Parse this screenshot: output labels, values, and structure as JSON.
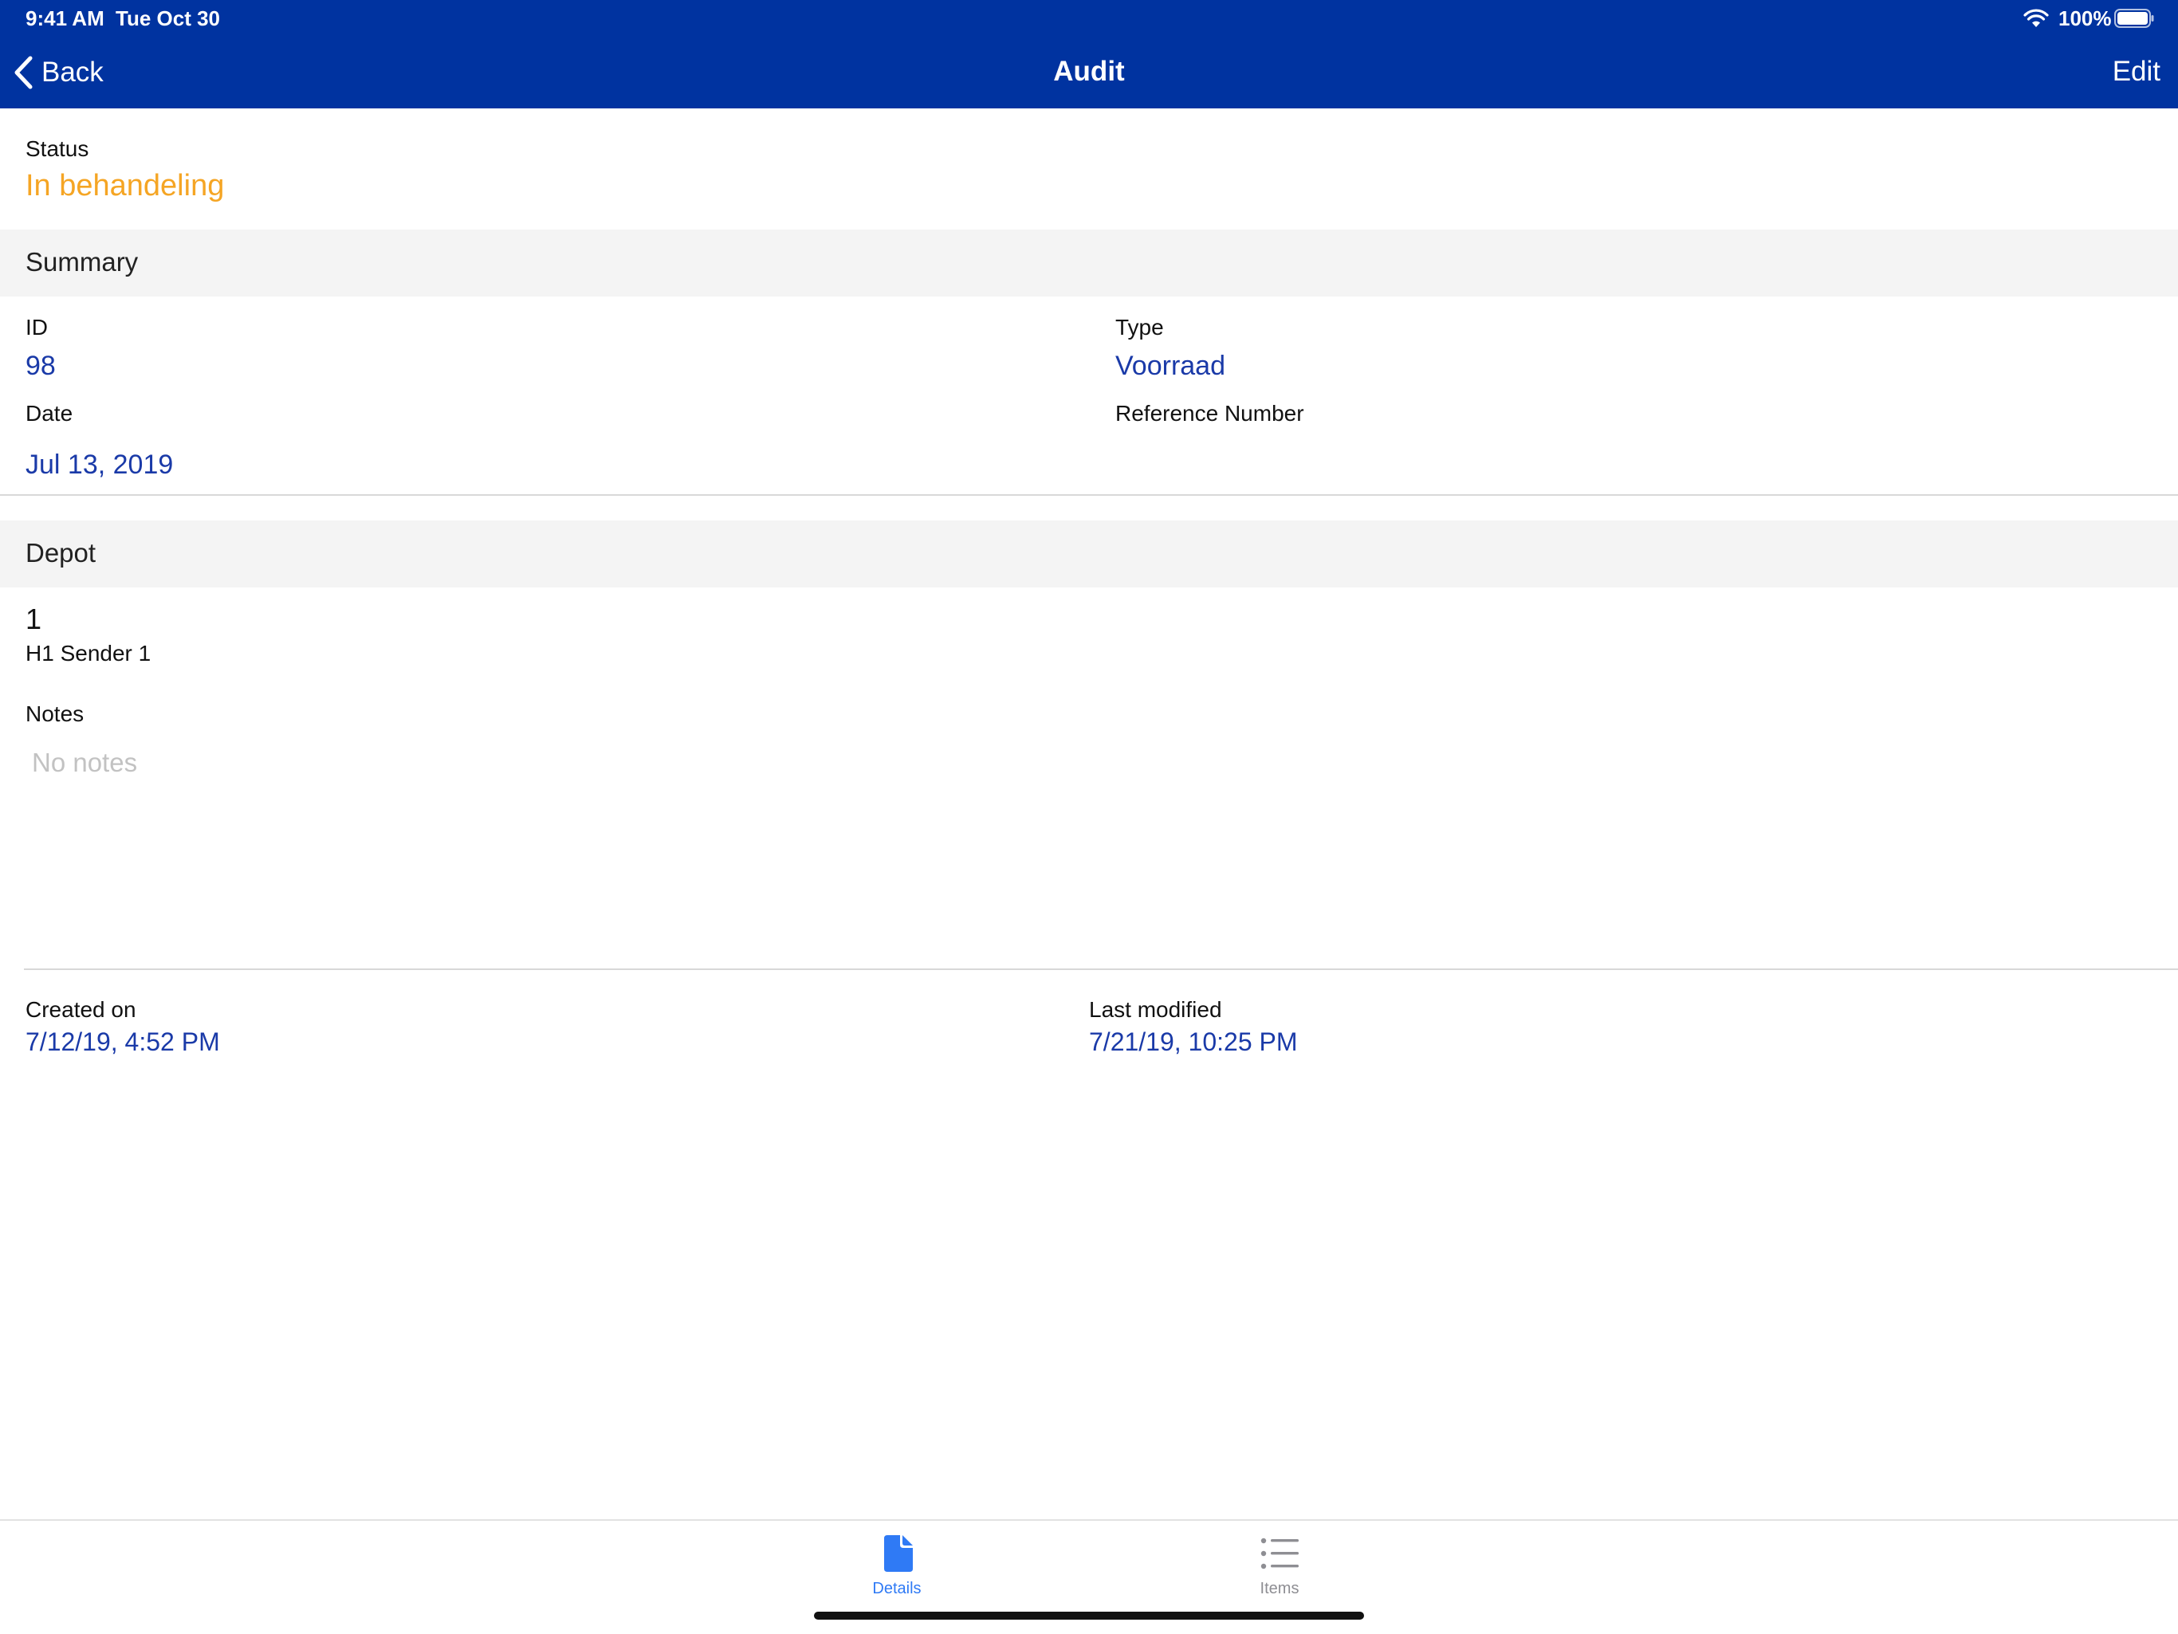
{
  "status_bar": {
    "time": "9:41 AM",
    "date": "Tue Oct 30",
    "battery": "100%"
  },
  "nav": {
    "back_label": "Back",
    "title": "Audit",
    "edit_label": "Edit"
  },
  "status": {
    "label": "Status",
    "value": "In behandeling",
    "value_color": "#f5a524"
  },
  "summary": {
    "title": "Summary",
    "id_label": "ID",
    "id_value": "98",
    "type_label": "Type",
    "type_value": "Voorraad",
    "date_label": "Date",
    "date_value": "Jul 13, 2019",
    "reference_label": "Reference Number"
  },
  "depot": {
    "title": "Depot",
    "code": "1",
    "name": "H1 Sender 1"
  },
  "notes": {
    "label": "Notes",
    "placeholder": "No notes"
  },
  "meta": {
    "created_label": "Created on",
    "created_value": "7/12/19, 4:52 PM",
    "modified_label": "Last modified",
    "modified_value": "7/21/19, 10:25 PM"
  },
  "tabs": [
    {
      "label": "Details",
      "icon": "document-icon",
      "selected": true
    },
    {
      "label": "Items",
      "icon": "list-icon",
      "selected": false
    }
  ],
  "colors": {
    "nav_background": "#0033a0",
    "link_value": "#1a3aa8",
    "tab_selected": "#2f7af5",
    "tab_unselected": "#8e8e93"
  }
}
